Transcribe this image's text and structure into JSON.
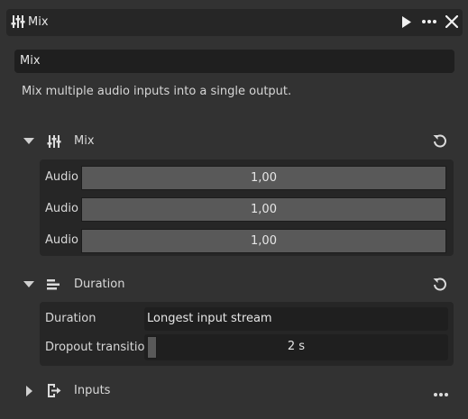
{
  "window": {
    "title": "Mix"
  },
  "node": {
    "name_value": "Mix",
    "description": "Mix multiple audio inputs into a single output."
  },
  "sections": {
    "mix": {
      "label": "Mix",
      "expanded": true,
      "rows": [
        {
          "label": "Audio",
          "value": "1,00"
        },
        {
          "label": "Audio",
          "value": "1,00"
        },
        {
          "label": "Audio",
          "value": "1,00"
        }
      ]
    },
    "duration": {
      "label": "Duration",
      "expanded": true,
      "duration_label": "Duration",
      "duration_value": "Longest input stream",
      "dropout_label": "Dropout transition",
      "dropout_value": "2 s",
      "dropout_fraction": 0.0
    },
    "inputs": {
      "label": "Inputs",
      "expanded": false
    }
  },
  "icons": {
    "title": "sliders-icon",
    "play": "play-icon",
    "more": "more-icon",
    "close": "close-icon",
    "reset": "reset-icon",
    "duration": "align-left-icon",
    "inputs": "input-icon"
  },
  "colors": {
    "background": "#323232",
    "panel": "#262626",
    "field": "#1f1f1f",
    "slider": "#595959",
    "text": "#dcdcdc"
  }
}
